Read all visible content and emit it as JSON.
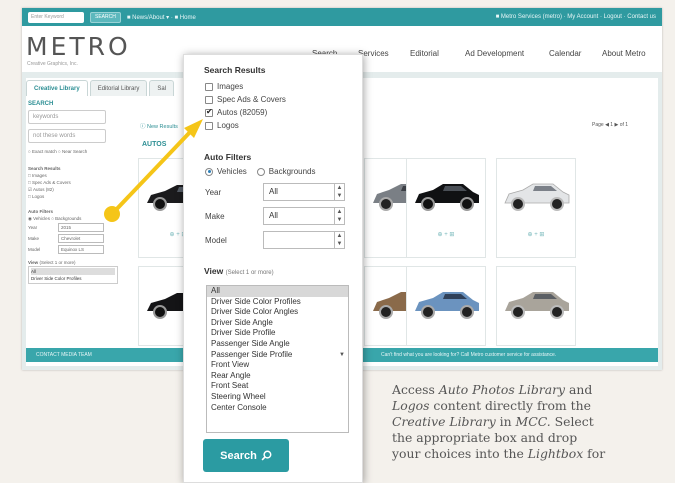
{
  "topbar": {
    "search_placeholder": "Enter Keyword",
    "search_button": "SEARCH",
    "left_links": "■ News/About ▾  ·  ■ Home",
    "right_links": "■ Metro Services (metro)  ·  My Account  ·  Logout  ·  Contact us"
  },
  "header": {
    "logo": "METRO",
    "logo_sub": "Creative Graphics, Inc.",
    "nav": [
      "Search",
      "Services",
      "Editorial",
      "Ad Development",
      "Calendar",
      "About Metro"
    ]
  },
  "tabs": [
    "Creative Library",
    "Editorial Library",
    "Sal"
  ],
  "sidebar": {
    "search_label": "SEARCH",
    "keyword_placeholder": "keywords",
    "exclude_placeholder": "not these words",
    "match_text": "○ Exact match   ○ Near Search",
    "results_label": "Search Results",
    "results_options": [
      "□ Images",
      "□ Spec Ads & Covers",
      "☑ Autos (82)",
      "□ Logos"
    ],
    "filters_label": "Auto Filters",
    "filters_radio": "◉ Vehicles  ○ Backgrounds",
    "year_label": "Year",
    "year_value": "2015",
    "make_label": "Make",
    "make_value": "Chevrolet",
    "model_label": "Model",
    "model_value": "Equinox LS",
    "view_label": "View",
    "view_hint": "(Select 1 or more)",
    "view_items": [
      "All",
      "Driver Side Color Profiles"
    ]
  },
  "main": {
    "breadcrumb": "ⓘ New Results",
    "section_title": "AUTOS",
    "pager": "Page ◀ 1 ▶ of 1"
  },
  "footer": {
    "left_link": "CONTACT MEDIA TEAM",
    "right_text": "Can't find what you are looking for? Call Metro customer service for assistance."
  },
  "dropdown": {
    "results_title": "Search Results",
    "results_options": [
      {
        "label": "Images",
        "checked": false
      },
      {
        "label": "Spec Ads & Covers",
        "checked": false
      },
      {
        "label": "Autos (82059)",
        "checked": true
      },
      {
        "label": "Logos",
        "checked": false
      }
    ],
    "filters_title": "Auto Filters",
    "filter_radios": [
      {
        "label": "Vehicles",
        "on": true
      },
      {
        "label": "Backgrounds",
        "on": false
      }
    ],
    "year_label": "Year",
    "year_value": "All",
    "make_label": "Make",
    "make_value": "All",
    "model_label": "Model",
    "model_value": "",
    "view_title": "View",
    "view_hint": "(Select 1 or more)",
    "view_options": [
      "All",
      "Driver Side Color Profiles",
      "Driver Side Color Angles",
      "Driver Side Angle",
      "Driver Side Profile",
      "Passenger Side Angle",
      "Passenger Side Profile",
      "Front View",
      "Rear Angle",
      "Front Seat",
      "Steering Wheel",
      "Center Console"
    ],
    "search_button": "Search"
  },
  "caption_lines": [
    [
      "Access ",
      "Auto Photos Library",
      " and"
    ],
    [
      "",
      "Logos",
      " content directly from the"
    ],
    [
      "",
      "Creative Library",
      " in "
    ],
    [
      "Select",
      "",
      ""
    ],
    [
      "the appropriate box and drop",
      "",
      ""
    ],
    [
      "your choices into the ",
      "Lightbox",
      " for"
    ]
  ],
  "caption_mcc": "MCC.",
  "colors": {
    "teal": "#2f9aa0",
    "accent": "#2b9ba2",
    "arrow": "#f5c518"
  }
}
